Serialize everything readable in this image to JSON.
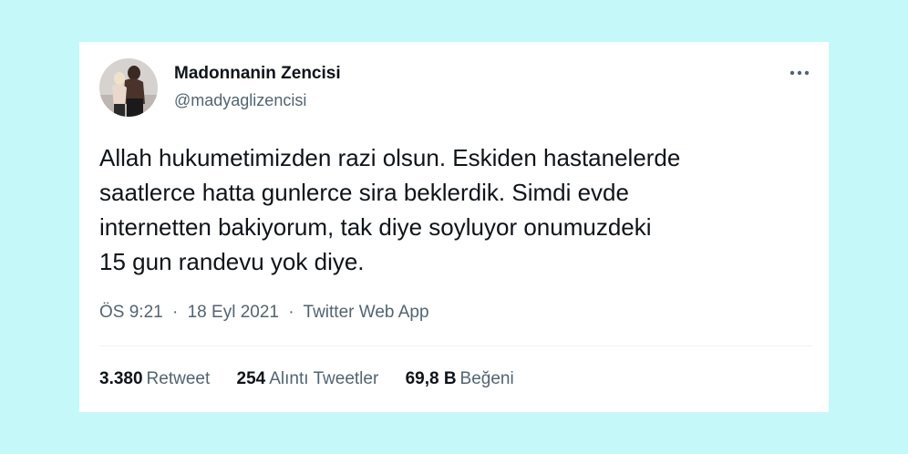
{
  "tweet": {
    "author": {
      "name": "Madonnanin Zencisi",
      "handle": "@madyaglizencisi",
      "avatar_icon": "profile-photo"
    },
    "more_icon": "more-horizontal-icon",
    "text_lines": [
      "Allah hukumetimizden razi olsun. Eskiden hastanelerde",
      "saatlerce hatta gunlerce sira beklerdik. Simdi evde",
      "internetten bakiyorum, tak diye soyluyor onumuzdeki",
      "15 gun randevu yok diye."
    ],
    "meta": {
      "time": "ÖS 9:21",
      "separator": "·",
      "date": "18 Eyl 2021",
      "source": "Twitter Web App"
    },
    "stats": {
      "retweets": {
        "count": "3.380",
        "label": "Retweet"
      },
      "quotes": {
        "count": "254",
        "label": "Alıntı Tweetler"
      },
      "likes": {
        "count": "69,8 B",
        "label": "Beğeni"
      }
    }
  },
  "colors": {
    "background": "#c5f8f8",
    "card": "#ffffff",
    "primary_text": "#0f1419",
    "secondary_text": "#536471",
    "divider": "#eff3f4"
  }
}
